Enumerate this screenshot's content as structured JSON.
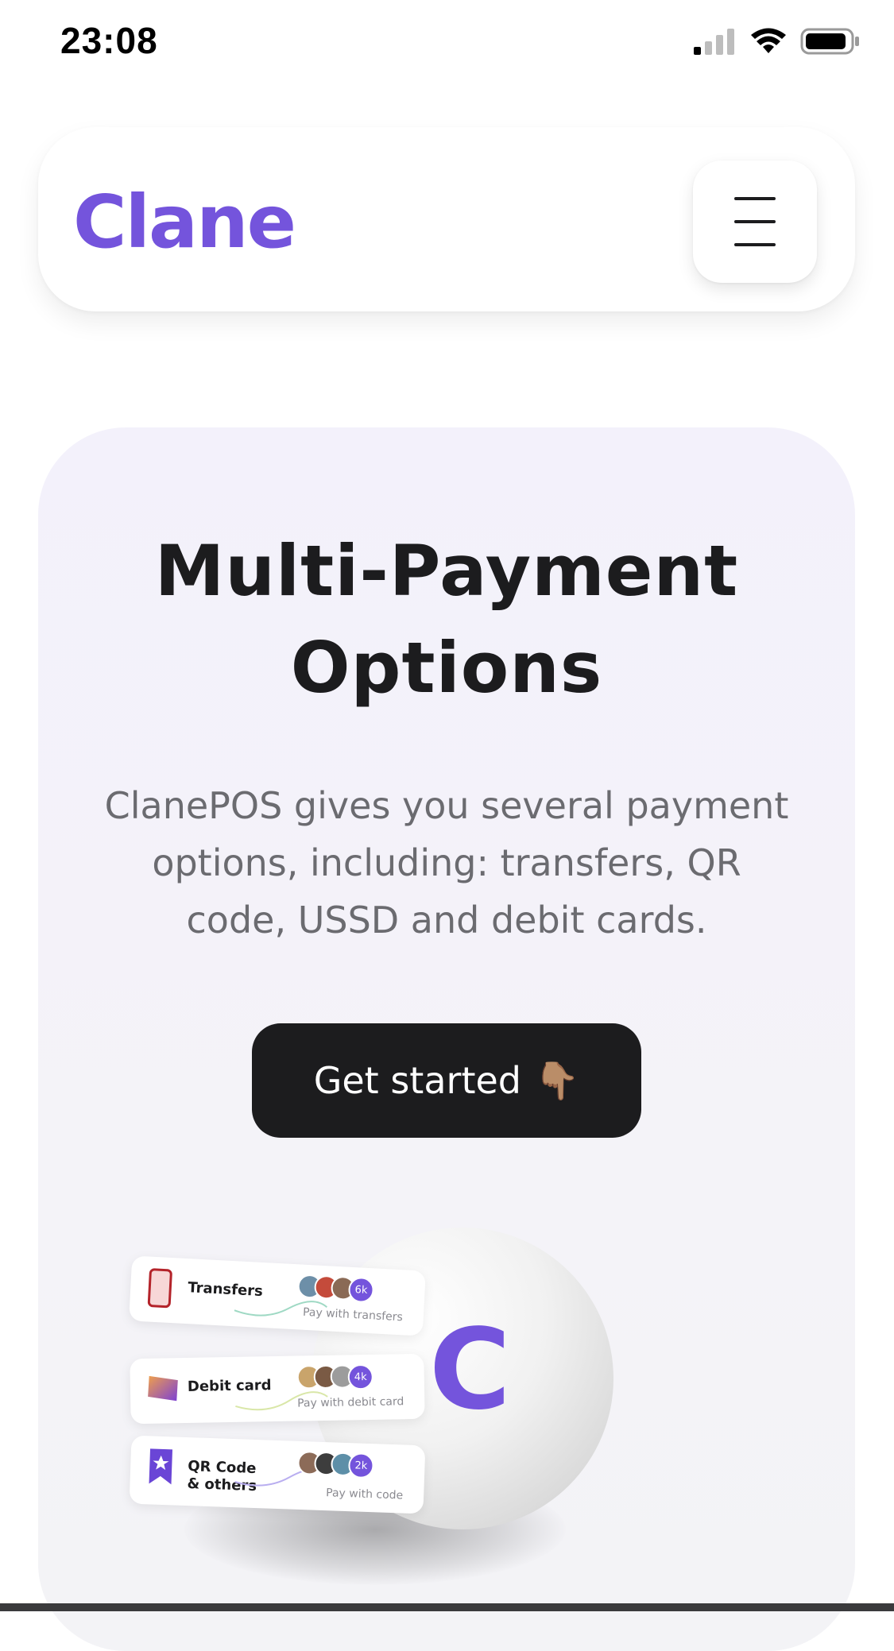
{
  "status_bar": {
    "time": "23:08"
  },
  "header": {
    "logo": "Clane"
  },
  "hero": {
    "title_line1": "Multi-Payment",
    "title_line2": "Options",
    "description": "ClanePOS gives you several payment options, including: transfers, QR code, USSD and debit cards.",
    "cta_label": "Get started",
    "cta_emoji": "👇🏽"
  },
  "illustration": {
    "sphere_letter": "C",
    "cards": [
      {
        "label": "Transfers",
        "count": "6k",
        "sub": "Pay with transfers"
      },
      {
        "label": "Debit card",
        "count": "4k",
        "sub": "Pay with debit card"
      },
      {
        "label_line1": "QR Code",
        "label_line2": "& others",
        "count": "2k",
        "sub": "Pay with code"
      }
    ]
  },
  "colors": {
    "brand": "#7454dc",
    "cta_bg": "#1c1c1e",
    "hero_bg": "#f3f2f9"
  }
}
